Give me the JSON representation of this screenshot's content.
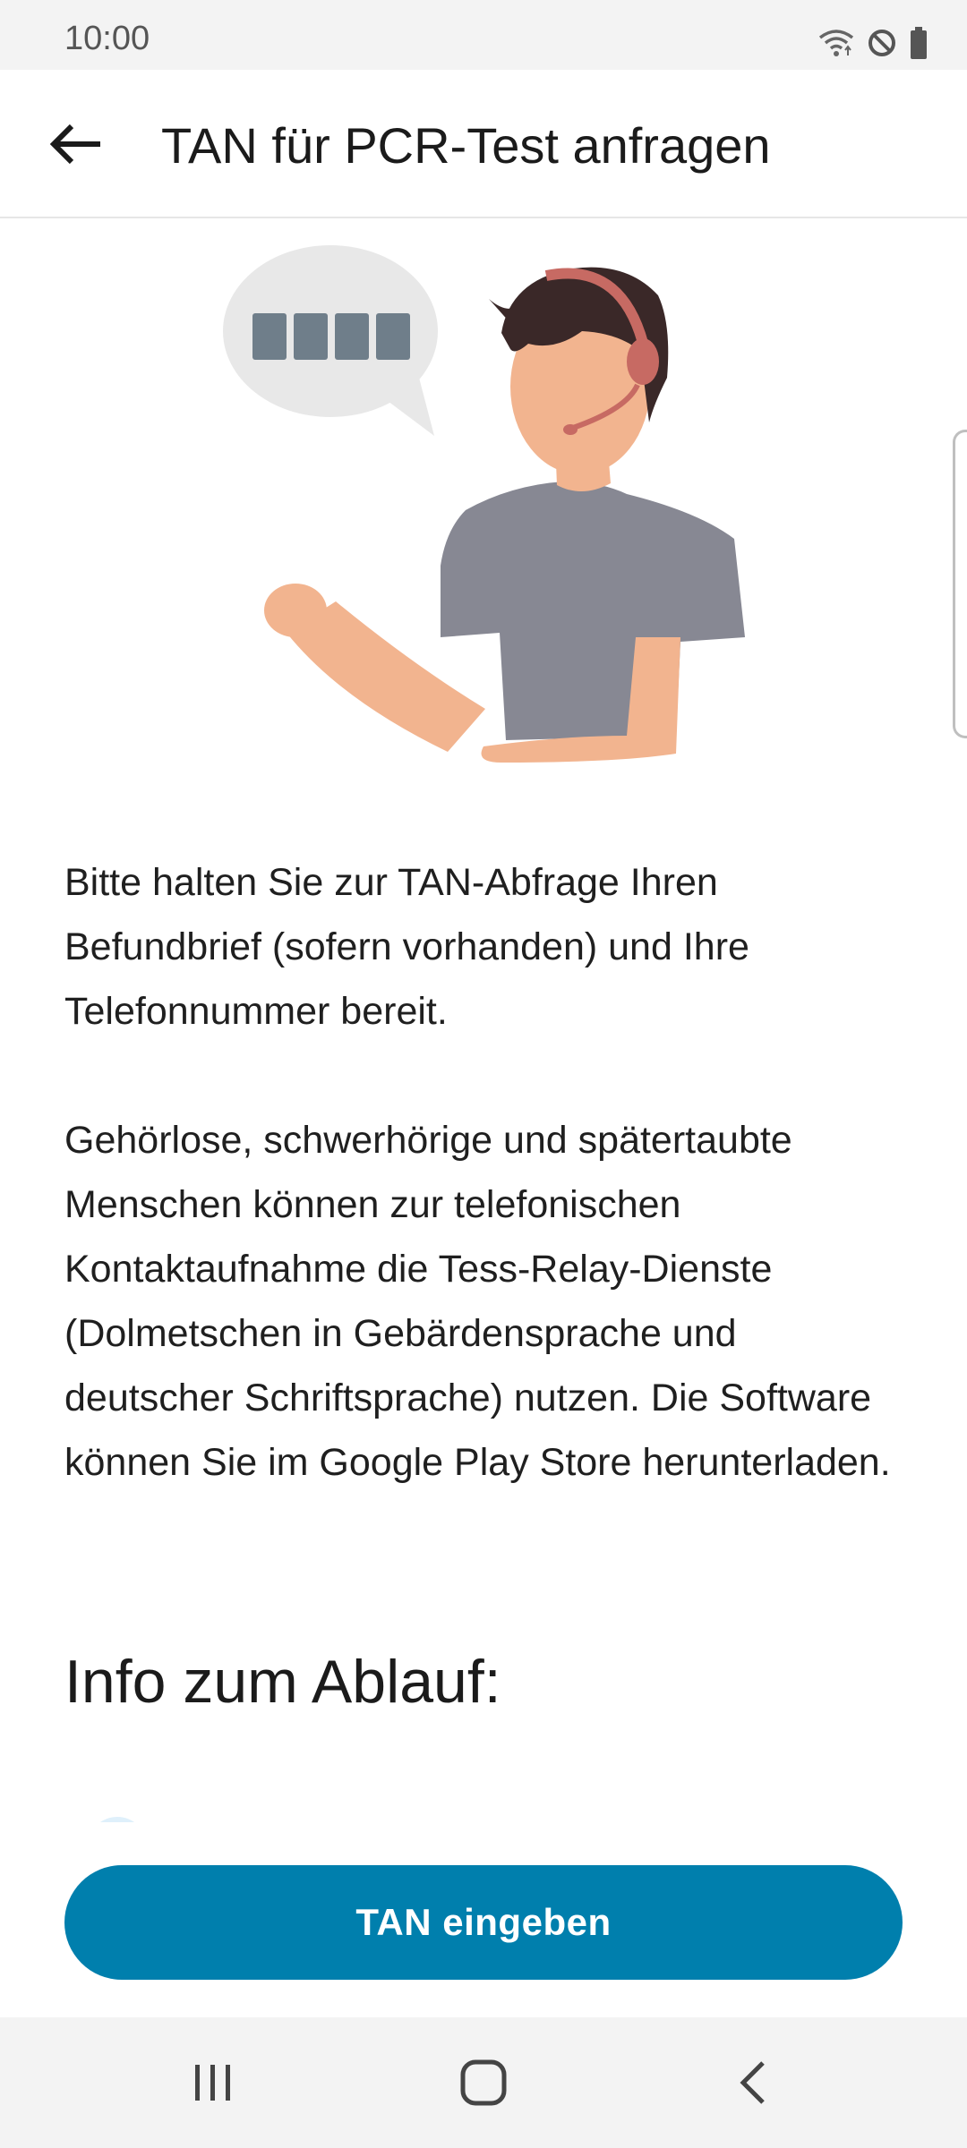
{
  "status_bar": {
    "time": "10:00",
    "icons": [
      "wifi-icon",
      "do-not-disturb-icon",
      "battery-icon"
    ]
  },
  "app_bar": {
    "title": "TAN für PCR-Test anfragen",
    "back_icon": "arrow-left-icon"
  },
  "illustration": {
    "bubble_code_boxes": 4
  },
  "content": {
    "paragraph_1": "Bitte halten Sie zur TAN-Abfrage Ihren Befundbrief (sofern vorhanden) und Ihre Telefonnummer bereit.",
    "paragraph_2": "Gehörlose, schwerhörige und spätertaubte Menschen können zur telefonischen Kontaktaufnahme die Tess-Relay-Dienste (Dolmetschen in Gebärdensprache und deutscher Schriftsprache) nutzen. Die Software können Sie im Google Play Store herunterladen.",
    "section_heading": "Info zum Ablauf:"
  },
  "primary_action": {
    "label": "TAN eingeben"
  },
  "colors": {
    "accent": "#007FAD",
    "bubble": "#E8E8E8",
    "bubble_box": "#6F7E8A",
    "shirt": "#878893",
    "skin": "#F2B48F",
    "hair": "#3A2828",
    "headset": "#C76A63"
  },
  "nav_bar": {
    "items": [
      "recent-apps-icon",
      "home-icon",
      "back-icon"
    ]
  }
}
